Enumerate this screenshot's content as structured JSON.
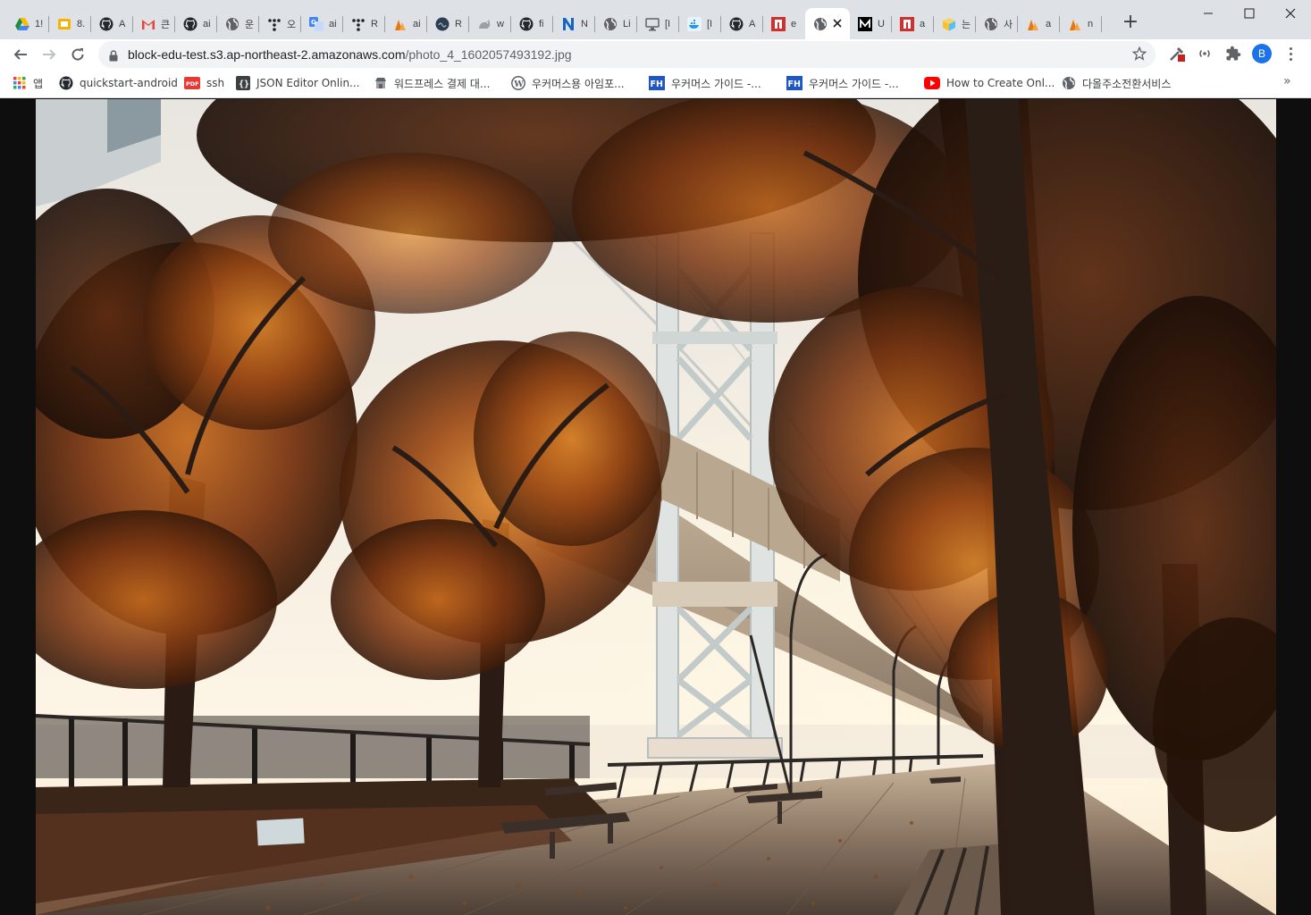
{
  "browser": {
    "tabs": [
      {
        "icon": "google-drive-icon",
        "title": "1!",
        "color": "#1e8e3e"
      },
      {
        "icon": "google-slides-icon",
        "title": "8.",
        "color": "#f4b400"
      },
      {
        "icon": "github-icon",
        "title": "A",
        "color": "#24292e"
      },
      {
        "icon": "gmail-icon",
        "title": "큰",
        "color": "#ea4335"
      },
      {
        "icon": "github-icon",
        "title": "ai",
        "color": "#24292e"
      },
      {
        "icon": "globe-icon",
        "title": "운",
        "color": "#5f6368"
      },
      {
        "icon": "figma-dots-icon",
        "title": "오",
        "color": "#202124"
      },
      {
        "icon": "translate-icon",
        "title": "ai",
        "color": "#4285f4"
      },
      {
        "icon": "figma-dots-icon",
        "title": "R",
        "color": "#202124"
      },
      {
        "icon": "aws-s3-icon",
        "title": "ai",
        "color": "#e47911"
      },
      {
        "icon": "dark-circle-icon",
        "title": "R",
        "color": "#2d3e50"
      },
      {
        "icon": "cat-icon",
        "title": "w",
        "color": "#9aa0a6"
      },
      {
        "icon": "github-icon",
        "title": "fi",
        "color": "#24292e"
      },
      {
        "icon": "notion-n-icon",
        "title": "N",
        "color": "#1565c0"
      },
      {
        "icon": "globe-icon",
        "title": "Li",
        "color": "#5f6368"
      },
      {
        "icon": "monitor-icon",
        "title": "[I",
        "color": "#5f6368"
      },
      {
        "icon": "docker-icon",
        "title": "[I",
        "color": "#2496ed"
      },
      {
        "icon": "github-icon",
        "title": "A",
        "color": "#24292e"
      },
      {
        "icon": "red-box-icon",
        "title": "e",
        "color": "#d32f2f"
      },
      {
        "icon": "globe-icon",
        "title": "",
        "color": "#5f6368",
        "active": true
      },
      {
        "icon": "medium-m-icon",
        "title": "U",
        "color": "#000000"
      },
      {
        "icon": "red-box-icon",
        "title": "a",
        "color": "#d32f2f"
      },
      {
        "icon": "package-icon",
        "title": "는",
        "color": "#4fc3f7"
      },
      {
        "icon": "globe-icon",
        "title": "사",
        "color": "#5f6368"
      },
      {
        "icon": "aws-s3-icon",
        "title": "a",
        "color": "#e47911"
      },
      {
        "icon": "aws-s3-icon",
        "title": "n",
        "color": "#e47911"
      }
    ],
    "new_tab_label": "+",
    "address": {
      "host": "block-edu-test.s3.ap-northeast-2.amazonaws.com",
      "path": "/photo_4_1602057493192.jpg"
    },
    "profile_initial": "B",
    "bookmarks": [
      {
        "icon": "apps-grid-icon",
        "label": "앱"
      },
      {
        "icon": "github-icon",
        "label": "quickstart-android"
      },
      {
        "icon": "pdf-icon",
        "label": "ssh"
      },
      {
        "icon": "json-editor-icon",
        "label": "JSON Editor Onlin..."
      },
      {
        "icon": "shop-icon",
        "label": "워드프레스 결제 대..."
      },
      {
        "icon": "wordpress-icon",
        "label": "우커머스용 아임포..."
      },
      {
        "icon": "fh-icon",
        "label": "우커머스 가이드 -..."
      },
      {
        "icon": "fh-icon",
        "label": "우커머스 가이드 -..."
      },
      {
        "icon": "youtube-icon",
        "label": "How to Create Onl..."
      },
      {
        "icon": "globe-icon",
        "label": "다올주소전환서비스"
      }
    ],
    "bookmarks_overflow": "»"
  },
  "colors": {
    "tabstrip": "#dee1e6",
    "omnibox": "#f1f3f4",
    "profile": "#1a73e8",
    "viewer_background": "#0e0e0e"
  }
}
